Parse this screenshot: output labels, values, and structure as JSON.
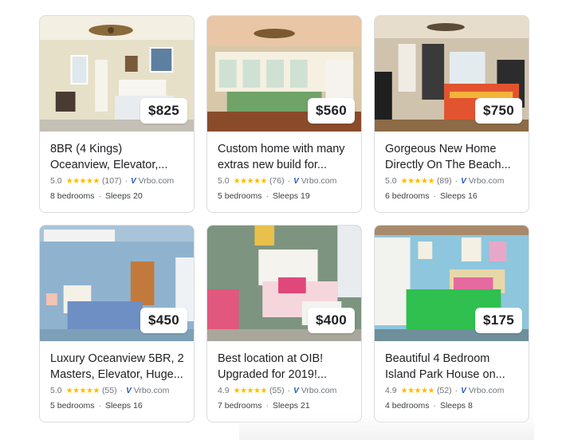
{
  "colors": {
    "star": "#fbbc04",
    "vrbo": "#245abc",
    "text": "#202124",
    "muted": "#70757a",
    "border": "#dadce0"
  },
  "listings": [
    {
      "price": "$825",
      "title_line1": "8BR (4 Kings)",
      "title_line2": "Oceanview, Elevator,...",
      "rating": "5.0",
      "stars": "★★★★★",
      "reviews": "(107)",
      "source": "Vrbo.com",
      "bedrooms": "8 bedrooms",
      "sleeps": "Sleeps 20"
    },
    {
      "price": "$560",
      "title_line1": "Custom home with many",
      "title_line2": "extras new build for...",
      "rating": "5.0",
      "stars": "★★★★★",
      "reviews": "(76)",
      "source": "Vrbo.com",
      "bedrooms": "5 bedrooms",
      "sleeps": "Sleeps 19"
    },
    {
      "price": "$750",
      "title_line1": "Gorgeous New Home",
      "title_line2": "Directly On The Beach...",
      "rating": "5.0",
      "stars": "★★★★★",
      "reviews": "(89)",
      "source": "Vrbo.com",
      "bedrooms": "6 bedrooms",
      "sleeps": "Sleeps 16"
    },
    {
      "price": "$450",
      "title_line1": "Luxury Oceanview 5BR, 2",
      "title_line2": "Masters, Elevator, Huge...",
      "rating": "5.0",
      "stars": "★★★★★",
      "reviews": "(55)",
      "source": "Vrbo.com",
      "bedrooms": "5 bedrooms",
      "sleeps": "Sleeps 16"
    },
    {
      "price": "$400",
      "title_line1": "Best location at OIB!",
      "title_line2": "Upgraded for 2019!...",
      "rating": "4.9",
      "stars": "★★★★★",
      "reviews": "(55)",
      "source": "Vrbo.com",
      "bedrooms": "7 bedrooms",
      "sleeps": "Sleeps 21"
    },
    {
      "price": "$175",
      "title_line1": "Beautiful 4 Bedroom",
      "title_line2": "Island Park House on...",
      "rating": "4.9",
      "stars": "★★★★★",
      "reviews": "(52)",
      "source": "Vrbo.com",
      "bedrooms": "4 bedrooms",
      "sleeps": "Sleeps 8"
    }
  ]
}
